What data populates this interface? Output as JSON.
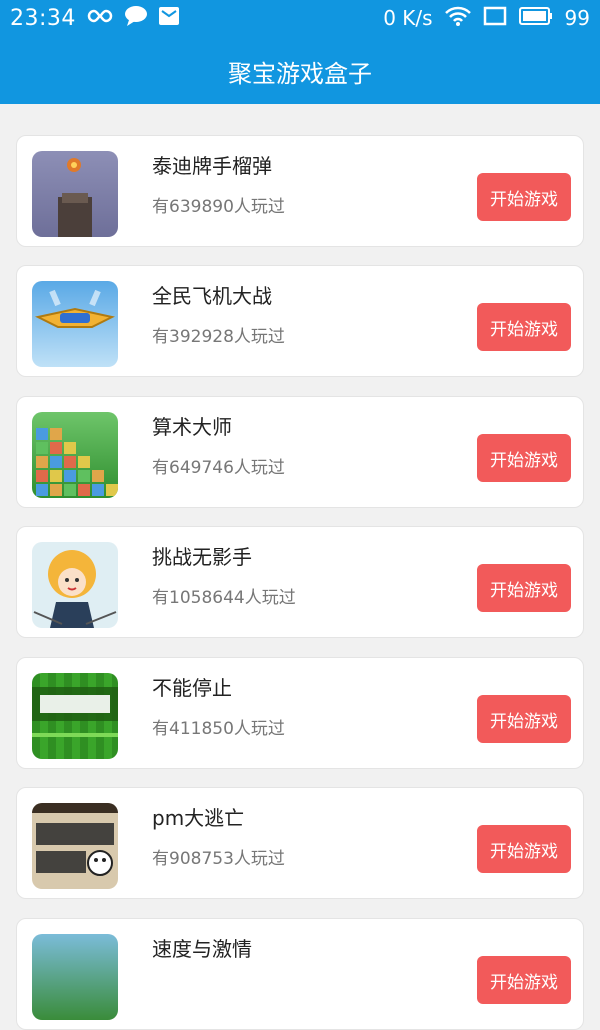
{
  "status": {
    "time": "23:34",
    "net_speed": "0 K/s",
    "battery": "99"
  },
  "app": {
    "title": "聚宝游戏盒子"
  },
  "games": [
    {
      "name": "泰迪牌手榴弹",
      "plays": "有639890人玩过",
      "button": "开始游戏",
      "icon": "grenade-game-icon"
    },
    {
      "name": "全民飞机大战",
      "plays": "有392928人玩过",
      "button": "开始游戏",
      "icon": "plane-game-icon"
    },
    {
      "name": "算术大师",
      "plays": "有649746人玩过",
      "button": "开始游戏",
      "icon": "math-game-icon"
    },
    {
      "name": "挑战无影手",
      "plays": "有1058644人玩过",
      "button": "开始游戏",
      "icon": "hand-game-icon"
    },
    {
      "name": "不能停止",
      "plays": "有411850人玩过",
      "button": "开始游戏",
      "icon": "nonstop-game-icon"
    },
    {
      "name": "pm大逃亡",
      "plays": "有908753人玩过",
      "button": "开始游戏",
      "icon": "pm-escape-game-icon"
    },
    {
      "name": "速度与激情",
      "plays": "",
      "button": "开始游戏",
      "icon": "speed-game-icon"
    }
  ],
  "colors": {
    "primary": "#1196e0",
    "button": "#f25a5a"
  }
}
